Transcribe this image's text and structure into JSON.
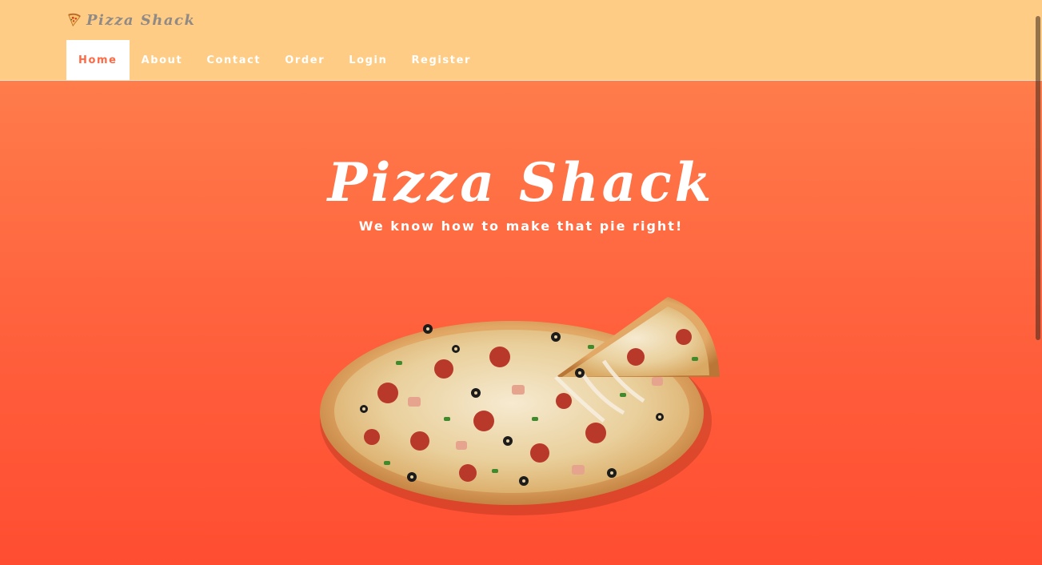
{
  "brand": {
    "name": "Pizza Shack",
    "icon": "pizza-slice-icon"
  },
  "nav": {
    "items": [
      {
        "label": "Home",
        "active": true
      },
      {
        "label": "About",
        "active": false
      },
      {
        "label": "Contact",
        "active": false
      },
      {
        "label": "Order",
        "active": false
      },
      {
        "label": "Login",
        "active": false
      },
      {
        "label": "Register",
        "active": false
      }
    ]
  },
  "hero": {
    "title": "Pizza Shack",
    "subtitle": "We know how to make that pie right!"
  },
  "colors": {
    "navbar": "#ffcc85",
    "hero_top": "#ff7c4b",
    "hero_bottom": "#ff4d31",
    "active_text": "#ff6a45"
  }
}
